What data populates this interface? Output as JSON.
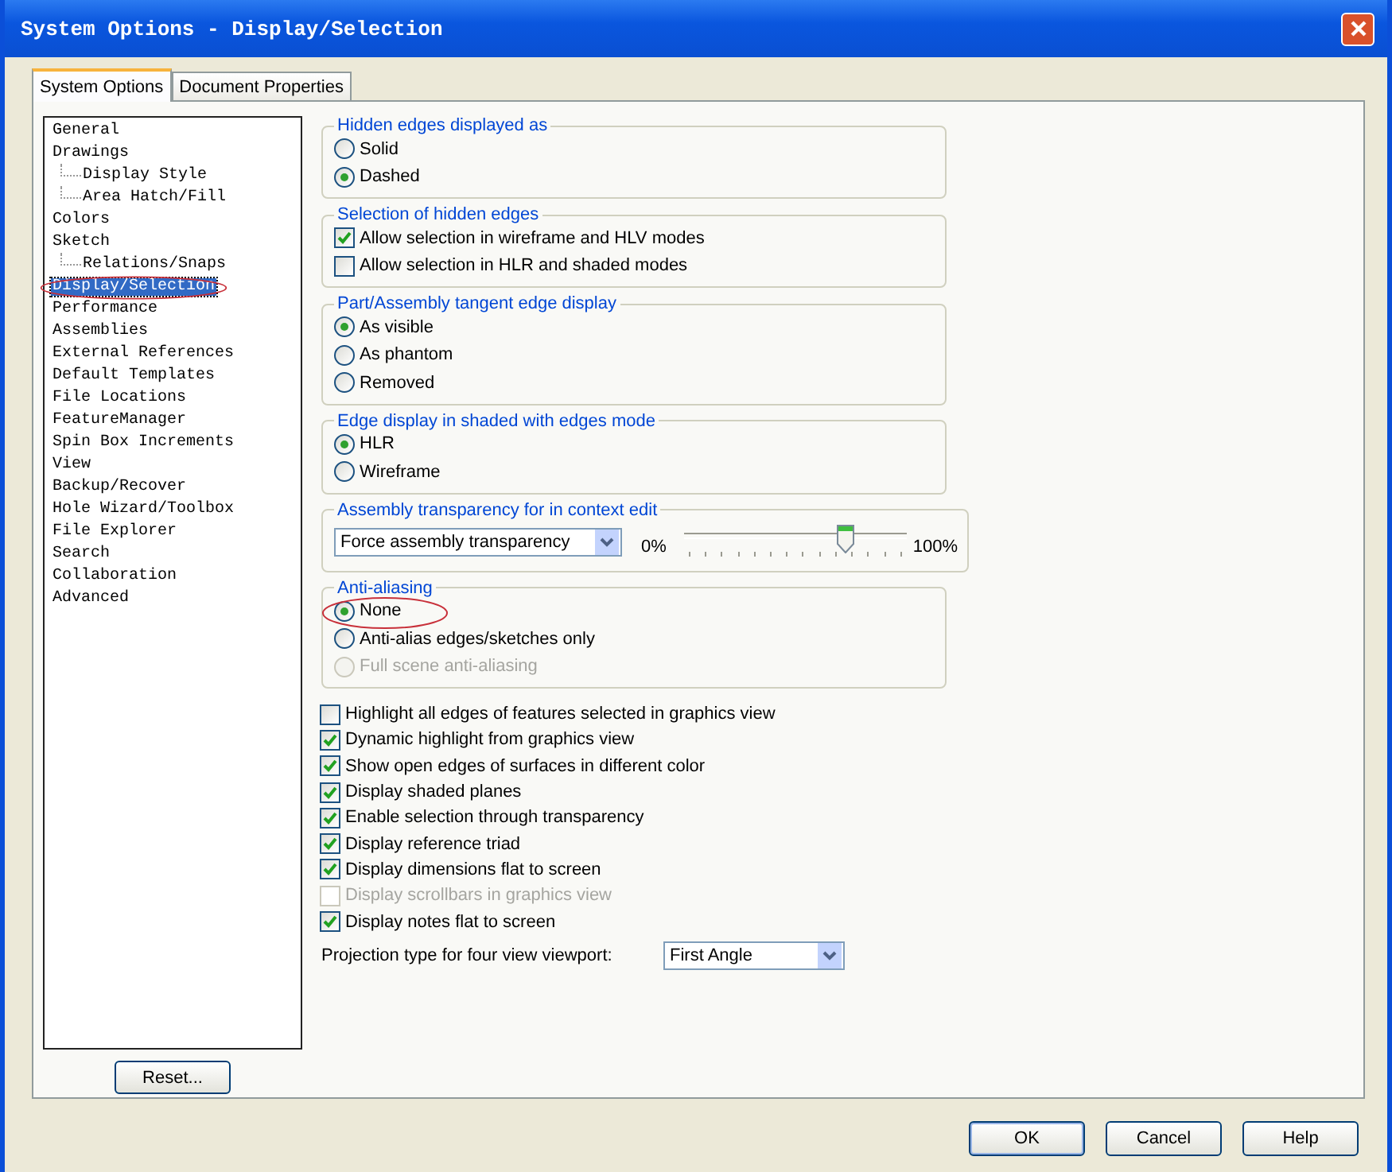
{
  "window": {
    "title": "System Options - Display/Selection"
  },
  "tabs": [
    {
      "label": "System Options",
      "selected": true
    },
    {
      "label": "Document Properties",
      "selected": false
    }
  ],
  "tree": [
    {
      "label": "General",
      "selected": false
    },
    {
      "label": "Drawings",
      "selected": false,
      "children": [
        {
          "label": "Display Style",
          "selected": false
        },
        {
          "label": "Area Hatch/Fill",
          "selected": false
        }
      ]
    },
    {
      "label": "Colors",
      "selected": false
    },
    {
      "label": "Sketch",
      "selected": false,
      "children": [
        {
          "label": "Relations/Snaps",
          "selected": false
        }
      ]
    },
    {
      "label": "Display/Selection",
      "selected": true
    },
    {
      "label": "Performance",
      "selected": false
    },
    {
      "label": "Assemblies",
      "selected": false
    },
    {
      "label": "External References",
      "selected": false
    },
    {
      "label": "Default Templates",
      "selected": false
    },
    {
      "label": "File Locations",
      "selected": false
    },
    {
      "label": "FeatureManager",
      "selected": false
    },
    {
      "label": "Spin Box Increments",
      "selected": false
    },
    {
      "label": "View",
      "selected": false
    },
    {
      "label": "Backup/Recover",
      "selected": false
    },
    {
      "label": "Hole Wizard/Toolbox",
      "selected": false
    },
    {
      "label": "File Explorer",
      "selected": false
    },
    {
      "label": "Search",
      "selected": false
    },
    {
      "label": "Collaboration",
      "selected": false
    },
    {
      "label": "Advanced",
      "selected": false
    }
  ],
  "reset_button": "Reset...",
  "groups": [
    {
      "title": "Hidden edges displayed as",
      "items": [
        {
          "kind": "radio",
          "label": "Solid",
          "selected": false,
          "disabled": false
        },
        {
          "kind": "radio",
          "label": "Dashed",
          "selected": true,
          "disabled": false
        }
      ]
    },
    {
      "title": "Selection of hidden edges",
      "items": [
        {
          "kind": "checkbox",
          "label": "Allow selection in wireframe and HLV modes",
          "checked": true,
          "disabled": false
        },
        {
          "kind": "checkbox",
          "label": "Allow selection in HLR and shaded modes",
          "checked": false,
          "disabled": false
        }
      ]
    },
    {
      "title": "Part/Assembly tangent edge display",
      "items": [
        {
          "kind": "radio",
          "label": "As visible",
          "selected": true,
          "disabled": false
        },
        {
          "kind": "radio",
          "label": "As phantom",
          "selected": false,
          "disabled": false
        },
        {
          "kind": "radio",
          "label": "Removed",
          "selected": false,
          "disabled": false
        }
      ]
    },
    {
      "title": "Edge display in shaded with edges mode",
      "items": [
        {
          "kind": "radio",
          "label": "HLR",
          "selected": true,
          "disabled": false
        },
        {
          "kind": "radio",
          "label": "Wireframe",
          "selected": false,
          "disabled": false
        }
      ]
    },
    {
      "title": "Assembly transparency for in context edit",
      "items": [
        {
          "kind": "slider",
          "dropdown": "Force assembly transparency",
          "min_label": "0%",
          "max_label": "100%",
          "level": 0.72
        }
      ]
    },
    {
      "title": "Anti-aliasing",
      "items": [
        {
          "kind": "radio",
          "label": "None",
          "selected": true,
          "disabled": false
        },
        {
          "kind": "radio",
          "label": "Anti-alias edges/sketches only",
          "selected": false,
          "disabled": false
        },
        {
          "kind": "radio",
          "label": "Full scene anti-aliasing",
          "selected": false,
          "disabled": true
        }
      ]
    }
  ],
  "options": [
    {
      "label": "Highlight all edges of features selected in graphics view",
      "checked": false,
      "disabled": false
    },
    {
      "label": "Dynamic highlight from graphics view",
      "checked": true,
      "disabled": false
    },
    {
      "label": "Show open edges of surfaces in different color",
      "checked": true,
      "disabled": false
    },
    {
      "label": "Display shaded planes",
      "checked": true,
      "disabled": false
    },
    {
      "label": "Enable selection through transparency",
      "checked": true,
      "disabled": false
    },
    {
      "label": "Display reference triad",
      "checked": true,
      "disabled": false
    },
    {
      "label": "Display dimensions flat to screen",
      "checked": true,
      "disabled": false
    },
    {
      "label": "Display scrollbars in graphics view",
      "checked": false,
      "disabled": true
    },
    {
      "label": "Display notes flat to screen",
      "checked": true,
      "disabled": false
    }
  ],
  "projection": {
    "label": "Projection type for four view viewport:",
    "value": "First Angle"
  },
  "buttons": [
    "OK",
    "Cancel",
    "Help"
  ]
}
